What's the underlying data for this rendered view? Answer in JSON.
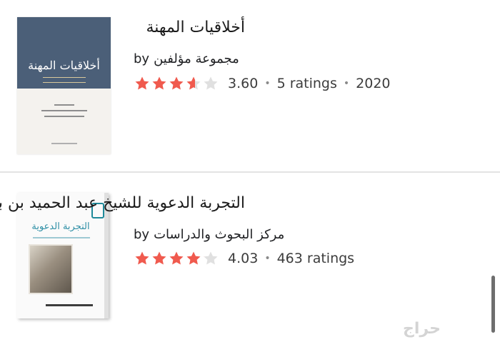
{
  "colors": {
    "star_filled": "#f05a4e",
    "star_empty": "#e0e0e0",
    "text_primary": "#202124",
    "divider": "#e3e3e3"
  },
  "books": [
    {
      "title": "أخلاقيات المهنة",
      "by_label": "by",
      "author": "مجموعة مؤلفين",
      "rating": "3.60",
      "rating_value": 3.6,
      "ratings_count": "5 ratings",
      "year": "2020",
      "cover_title": "أخلاقيات المهنة",
      "cover_icon": "book-cover"
    },
    {
      "title": "التجربة الدعوية للشيخ عبد الحميد بن باديس",
      "by_label": "by",
      "author": "مركز البحوث والدراسات",
      "rating": "4.03",
      "rating_value": 4.03,
      "ratings_count": "463 ratings",
      "cover_title": "التجربة الدعوية",
      "cover_icon": "book-cover"
    }
  ],
  "watermark": "حراج"
}
